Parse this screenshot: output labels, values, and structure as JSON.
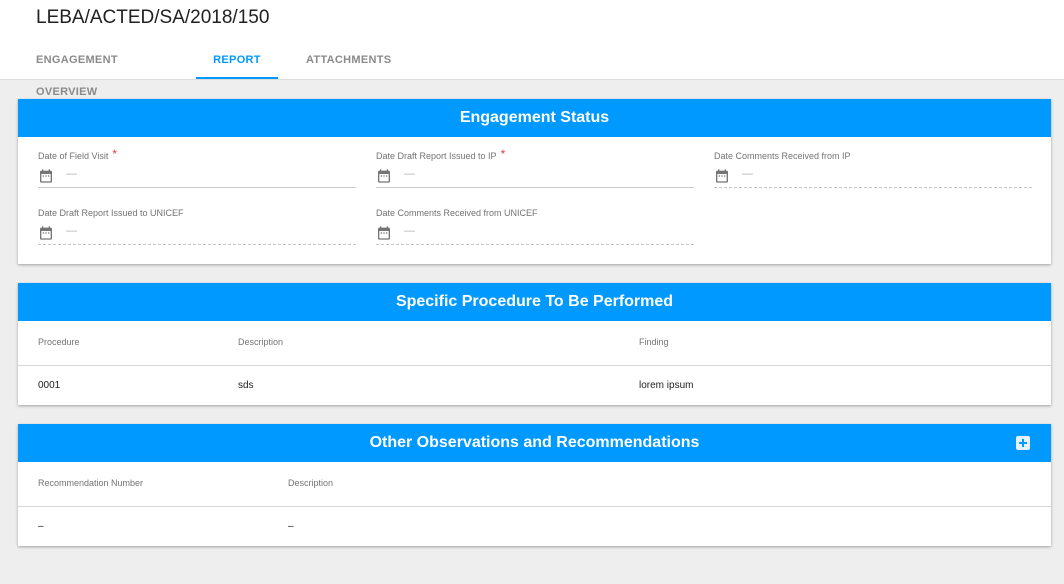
{
  "page": {
    "title": "LEBA/ACTED/SA/2018/150"
  },
  "tabs": [
    {
      "label": "ENGAGEMENT OVERVIEW",
      "active": false
    },
    {
      "label": "REPORT",
      "active": true
    },
    {
      "label": "ATTACHMENTS",
      "active": false
    }
  ],
  "colors": {
    "accent": "#0099ff",
    "required": "#e53935",
    "background": "#eeeeee"
  },
  "engagement_status": {
    "title": "Engagement Status",
    "fields": [
      {
        "label": "Date of Field Visit",
        "required": true,
        "value": "—",
        "icon": "calendar-icon"
      },
      {
        "label": "Date Draft Report Issued to IP",
        "required": true,
        "value": "—",
        "icon": "calendar-icon"
      },
      {
        "label": "Date Comments Received from IP",
        "required": false,
        "value": "—",
        "icon": "calendar-icon"
      },
      {
        "label": "Date Draft Report Issued to UNICEF",
        "required": false,
        "value": "—",
        "icon": "calendar-icon"
      },
      {
        "label": "Date Comments Received from UNICEF",
        "required": false,
        "value": "—",
        "icon": "calendar-icon"
      }
    ],
    "required_marker": "*"
  },
  "specific_procedure": {
    "title": "Specific Procedure To Be Performed",
    "columns": [
      "Procedure",
      "Description",
      "Finding"
    ],
    "rows": [
      [
        "0001",
        "sds",
        "lorem ipsum"
      ]
    ]
  },
  "other_observations": {
    "title": "Other Observations and Recommendations",
    "add_icon": "add-box-icon",
    "columns": [
      "Recommendation Number",
      "Description"
    ],
    "rows": [
      [
        "–",
        "–"
      ]
    ]
  }
}
